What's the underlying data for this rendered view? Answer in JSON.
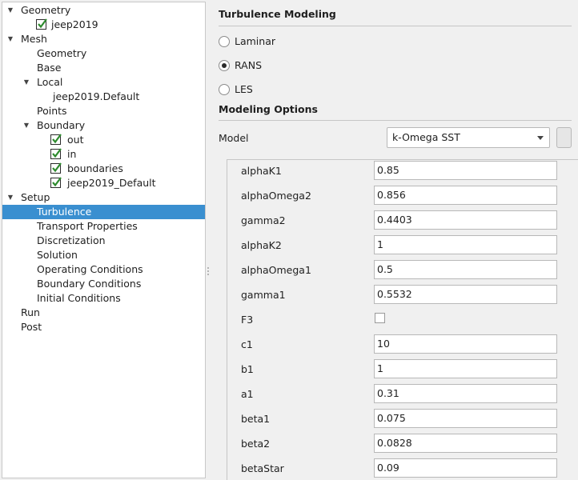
{
  "tree": {
    "items": [
      {
        "label": "Geometry",
        "level": 0,
        "expanded": true
      },
      {
        "label": "jeep2019",
        "level": 1,
        "checkbox": true
      },
      {
        "label": "Mesh",
        "level": 0,
        "expanded": true
      },
      {
        "label": "Geometry",
        "level": 1
      },
      {
        "label": "Base",
        "level": 1
      },
      {
        "label": "Local",
        "level": 1,
        "expanded": true
      },
      {
        "label": "jeep2019.Default",
        "level": 2
      },
      {
        "label": "Points",
        "level": 1
      },
      {
        "label": "Boundary",
        "level": 1,
        "expanded": true
      },
      {
        "label": "out",
        "level": 2,
        "checkbox": true
      },
      {
        "label": "in",
        "level": 2,
        "checkbox": true
      },
      {
        "label": "boundaries",
        "level": 2,
        "checkbox": true
      },
      {
        "label": "jeep2019_Default",
        "level": 2,
        "checkbox": true
      },
      {
        "label": "Setup",
        "level": 0,
        "expanded": true
      },
      {
        "label": "Turbulence",
        "level": 1,
        "selected": true
      },
      {
        "label": "Transport Properties",
        "level": 1
      },
      {
        "label": "Discretization",
        "level": 1
      },
      {
        "label": "Solution",
        "level": 1
      },
      {
        "label": "Operating Conditions",
        "level": 1
      },
      {
        "label": "Boundary Conditions",
        "level": 1
      },
      {
        "label": "Initial Conditions",
        "level": 1
      },
      {
        "label": "Run",
        "level": 0
      },
      {
        "label": "Post",
        "level": 0
      }
    ]
  },
  "turbulence": {
    "title": "Turbulence Modeling",
    "options": [
      {
        "label": "Laminar",
        "checked": false
      },
      {
        "label": "RANS",
        "checked": true
      },
      {
        "label": "LES",
        "checked": false
      }
    ]
  },
  "modeling": {
    "title": "Modeling Options",
    "model_label": "Model",
    "model_value": "k-Omega SST",
    "params": [
      {
        "name": "alphaK1",
        "value": "0.85"
      },
      {
        "name": "alphaOmega2",
        "value": "0.856"
      },
      {
        "name": "gamma2",
        "value": "0.4403"
      },
      {
        "name": "alphaK2",
        "value": "1"
      },
      {
        "name": "alphaOmega1",
        "value": "0.5"
      },
      {
        "name": "gamma1",
        "value": "0.5532"
      },
      {
        "name": "F3",
        "type": "checkbox",
        "checked": false
      },
      {
        "name": "c1",
        "value": "10"
      },
      {
        "name": "b1",
        "value": "1"
      },
      {
        "name": "a1",
        "value": "0.31"
      },
      {
        "name": "beta1",
        "value": "0.075"
      },
      {
        "name": "beta2",
        "value": "0.0828"
      },
      {
        "name": "betaStar",
        "value": "0.09"
      }
    ]
  },
  "colors": {
    "selection": "#3a8fd0",
    "check": "#2e8b2e"
  }
}
